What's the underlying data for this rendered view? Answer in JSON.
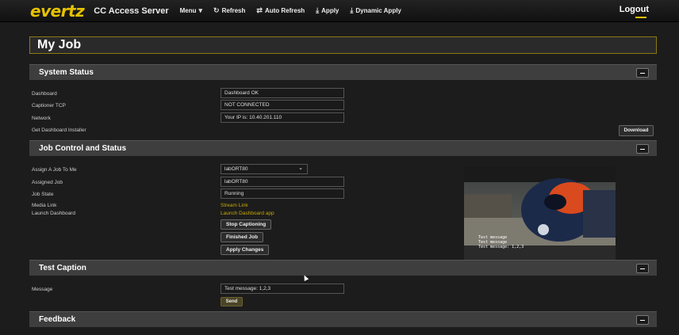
{
  "navbar": {
    "logo": "evertz",
    "brand": "CC Access Server",
    "menu": "Menu",
    "refresh": "Refresh",
    "auto_refresh": "Auto Refresh",
    "apply": "Apply",
    "dynamic_apply": "Dynamic Apply",
    "logout": "Logout"
  },
  "page_title": "My Job",
  "system_status": {
    "header": "System Status",
    "dashboard_label": "Dashboard",
    "dashboard_value": "Dashboard OK",
    "captioner_label": "Captioner TCP",
    "captioner_value": "NOT CONNECTED",
    "network_label": "Network",
    "network_value": "Your IP is: 10.40.201.110",
    "installer_label": "Get Dashboard Installer",
    "download_label": "Download"
  },
  "job_control": {
    "header": "Job Control and Status",
    "assign_label": "Assign A Job To Me",
    "assign_value": "labORT80",
    "assigned_label": "Assigned Job",
    "assigned_value": "labORT80",
    "state_label": "Job State",
    "state_value": "Running",
    "media_label": "Media Link",
    "media_link": "Stream Link",
    "launch_label": "Launch Dashboard",
    "launch_link": "Launch Dashboard app",
    "stop_button": "Stop Captioning",
    "finished_button": "Finished Job",
    "apply_button": "Apply Changes",
    "video_caption": [
      "Test message",
      "Test message",
      "Test message: 1,2,3"
    ]
  },
  "test_caption": {
    "header": "Test Caption",
    "message_label": "Message",
    "message_value": "Test message: 1,2,3",
    "send_label": "Send"
  },
  "feedback": {
    "header": "Feedback"
  },
  "colors": {
    "accent": "#e6c200",
    "background": "#1c1c1c",
    "section": "#3e3e3e"
  }
}
